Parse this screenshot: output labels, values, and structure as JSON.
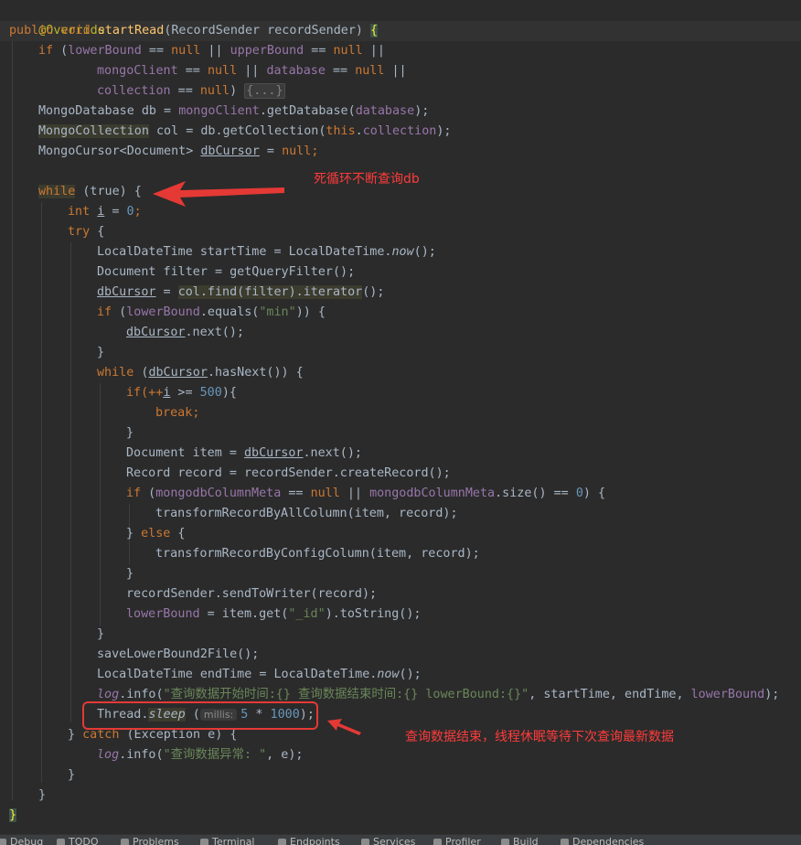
{
  "code": {
    "annotation": "@Override",
    "kw_public": "public",
    "kw_void": "void",
    "method_name": "startRead",
    "param_type": "(RecordSender recordSender) ",
    "open_brace": "{",
    "kw_if": "if",
    "if1_open": " (",
    "f_lowerBound": "lowerBound",
    "eq_null": " == ",
    "kw_null": "null",
    "or": " || ",
    "f_upperBound": "upperBound",
    "f_mongoClient": "mongoClient",
    "f_database": "database",
    "f_collection": "collection",
    "paren_close": ") ",
    "folded": "{...}",
    "l5_a": "MongoDatabase db = ",
    "l5_b": ".getDatabase(",
    "l5_c": ");",
    "l6_type": "MongoCollection",
    "l6_a": " col = db.getCollection(",
    "kw_this": "this",
    "l6_b": ".",
    "l7_a": "MongoCursor<Document> ",
    "v_dbCursor": "dbCursor",
    "l7_b": " = ",
    "semi": ";",
    "kw_while": "while",
    "kw_true": " (true) {",
    "kw_int": "int",
    "v_i": "i",
    "eq": " = ",
    "n_0": "0",
    "kw_try": "try",
    "brace_open": " {",
    "l12": "LocalDateTime startTime = LocalDateTime.",
    "m_now": "now",
    "call_end": "();",
    "l13": "Document filter = getQueryFilter();",
    "l14_a": "col.find(filter).iterator",
    "l15_a": ".equals(",
    "s_min": "\"min\"",
    "l15_b": ")) {",
    "l16": ".next();",
    "close_brace": "}",
    "l18_a": ".hasNext()) {",
    "l19_a": "if(++",
    "l19_b": " >= ",
    "n_500": "500",
    "l19_c": "){",
    "kw_break": "break",
    "l22_a": "Document item = ",
    "l22_b": ".next();",
    "l23": "Record record = recordSender.createRecord();",
    "f_mongoMeta": "mongodbColumnMeta",
    "l24_a": ".size() == ",
    "l24_b": ") {",
    "l25": "transformRecordByAllColumn(item, record);",
    "kw_else": "else",
    "l27": "transformRecordByConfigColumn(item, record);",
    "l29": "recordSender.sendToWriter(record);",
    "l30_a": " = item.get(",
    "s_id": "\"_id\"",
    "l30_b": ").toString();",
    "l32": "saveLowerBound2File();",
    "l33": "LocalDateTime endTime = LocalDateTime.",
    "f_log": "log",
    "l34_a": ".info(",
    "s_log1": "\"查询数据开始时间:{} 查询数据结束时间:{} lowerBound:{}\"",
    "l34_b": ", startTime, endTime, ",
    "l34_c": ");",
    "l35_a": "Thread.",
    "m_sleep": "sleep",
    "hint_millis": "millis:",
    "n_5": "5",
    "mul": " * ",
    "n_1000": "1000",
    "kw_catch": "catch",
    "l36_a": " (Exception e) {",
    "s_log2": "\"查询数据异常: \"",
    "l37_b": ", e);",
    "comma": ", "
  },
  "annotations": {
    "note1": "死循环不断查询db",
    "note2": "查询数据结束，线程休眠等待下次查询最新数据"
  },
  "tool_windows": [
    {
      "label": "Debug",
      "icon": "debug-icon"
    },
    {
      "label": "TODO",
      "icon": "todo-icon"
    },
    {
      "label": "Problems",
      "icon": "problems-icon"
    },
    {
      "label": "Terminal",
      "icon": "terminal-icon"
    },
    {
      "label": "Endpoints",
      "icon": "endpoints-icon"
    },
    {
      "label": "Services",
      "icon": "services-icon"
    },
    {
      "label": "Profiler",
      "icon": "profiler-icon"
    },
    {
      "label": "Build",
      "icon": "build-icon"
    },
    {
      "label": "Dependencies",
      "icon": "dependencies-icon"
    }
  ],
  "colors": {
    "background": "#2b2b2b",
    "keyword": "#cc7832",
    "field": "#9876aa",
    "method_decl": "#ffc66d",
    "number": "#6897bb",
    "string": "#6a8759",
    "annotation_red": "#e53935"
  }
}
